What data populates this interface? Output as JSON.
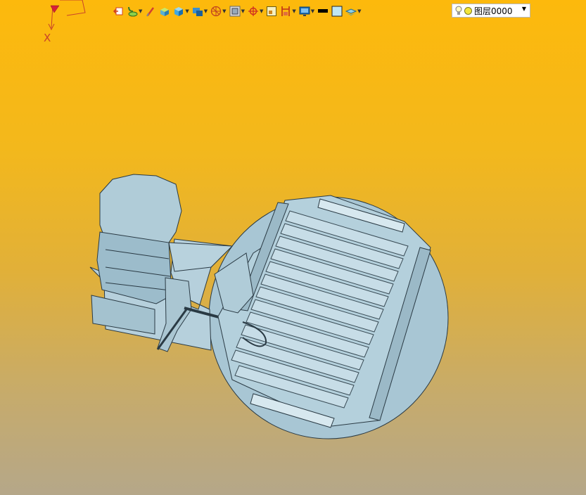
{
  "toolbar": {
    "items": [
      {
        "icon": "undo-to-origin-icon",
        "dropdown": false
      },
      {
        "icon": "tree-structure-icon",
        "dropdown": true
      },
      {
        "icon": "brush-icon",
        "dropdown": false
      },
      {
        "icon": "cube-edit-icon",
        "dropdown": false
      },
      {
        "icon": "solid-cube-icon",
        "dropdown": true
      },
      {
        "icon": "shaded-view-icon",
        "dropdown": true
      },
      {
        "icon": "view-sphere-icon",
        "dropdown": true
      },
      {
        "icon": "zoom-fit-icon",
        "dropdown": true
      },
      {
        "icon": "move-target-icon",
        "dropdown": true
      },
      {
        "icon": "window-frame-icon",
        "dropdown": false
      },
      {
        "icon": "section-view-icon",
        "dropdown": true
      },
      {
        "icon": "display-monitor-icon",
        "dropdown": true
      },
      {
        "icon": "black-line-icon",
        "dropdown": false
      },
      {
        "icon": "background-color-icon",
        "dropdown": false
      },
      {
        "icon": "layer-stack-icon",
        "dropdown": true
      }
    ]
  },
  "layer_combo": {
    "value": "图层0000",
    "icons": [
      "lightbulb-icon",
      "layer-color-dot-icon"
    ]
  },
  "triad": {
    "axis_label": "X"
  },
  "colors": {
    "background_top": "#fdb90c",
    "background_bottom": "#b5a789",
    "model_fill": "#a8c6d4",
    "model_edge": "#2a3a44"
  }
}
